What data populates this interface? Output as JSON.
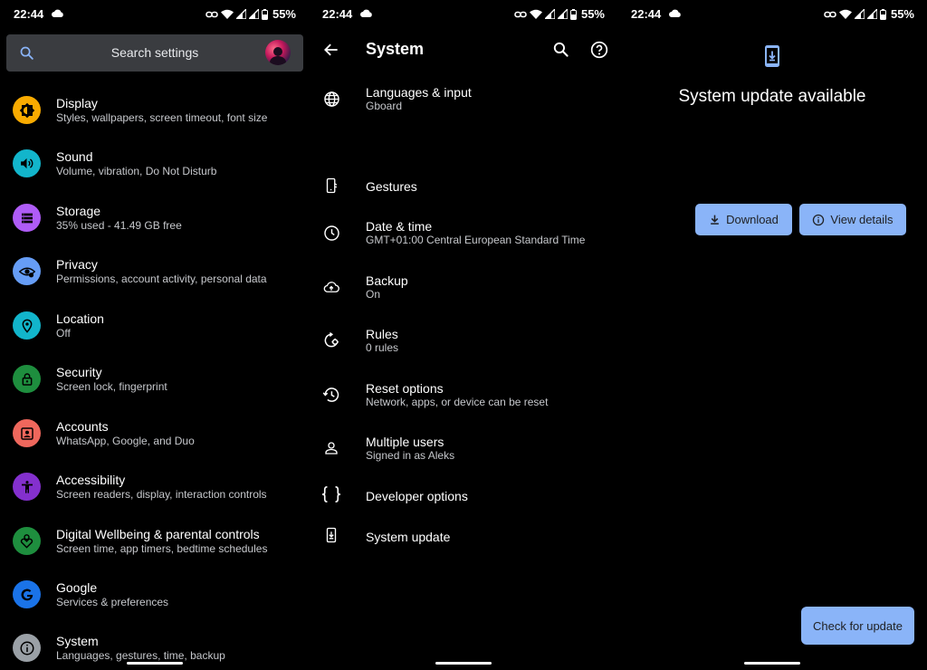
{
  "status_bar": {
    "time": "22:44",
    "battery": "55%"
  },
  "settings": {
    "search_placeholder": "Search settings",
    "items": [
      {
        "title": "Display",
        "subtitle": "Styles, wallpapers, screen timeout, font size",
        "icon": "brightness-icon",
        "color": "#f9ab00"
      },
      {
        "title": "Sound",
        "subtitle": "Volume, vibration, Do Not Disturb",
        "icon": "volume-icon",
        "color": "#12b5cb"
      },
      {
        "title": "Storage",
        "subtitle": "35% used - 41.49 GB free",
        "icon": "storage-icon",
        "color": "#af5cf7"
      },
      {
        "title": "Privacy",
        "subtitle": "Permissions, account activity, personal data",
        "icon": "privacy-eye-icon",
        "color": "#669df6"
      },
      {
        "title": "Location",
        "subtitle": "Off",
        "icon": "location-pin-icon",
        "color": "#12b5cb"
      },
      {
        "title": "Security",
        "subtitle": "Screen lock, fingerprint",
        "icon": "lock-icon",
        "color": "#1e8e3e"
      },
      {
        "title": "Accounts",
        "subtitle": "WhatsApp, Google, and Duo",
        "icon": "account-box-icon",
        "color": "#ee675c"
      },
      {
        "title": "Accessibility",
        "subtitle": "Screen readers, display, interaction controls",
        "icon": "accessibility-icon",
        "color": "#8430ce"
      },
      {
        "title": "Digital Wellbeing & parental controls",
        "subtitle": "Screen time, app timers, bedtime schedules",
        "icon": "wellbeing-icon",
        "color": "#1e8e3e"
      },
      {
        "title": "Google",
        "subtitle": "Services & preferences",
        "icon": "google-icon",
        "color": "#1a73e8"
      },
      {
        "title": "System",
        "subtitle": "Languages, gestures, time, backup",
        "icon": "info-icon",
        "color": "#9aa0a6"
      }
    ]
  },
  "system": {
    "title": "System",
    "items": [
      {
        "title": "Languages & input",
        "subtitle": "Gboard",
        "icon": "globe-icon"
      },
      {
        "title": "Gestures",
        "subtitle": "",
        "icon": "gestures-phone-icon"
      },
      {
        "title": "Date & time",
        "subtitle": "GMT+01:00 Central European Standard Time",
        "icon": "clock-icon"
      },
      {
        "title": "Backup",
        "subtitle": "On",
        "icon": "cloud-upload-icon"
      },
      {
        "title": "Rules",
        "subtitle": "0 rules",
        "icon": "rules-icon"
      },
      {
        "title": "Reset options",
        "subtitle": "Network, apps, or device can be reset",
        "icon": "history-icon"
      },
      {
        "title": "Multiple users",
        "subtitle": "Signed in as Aleks",
        "icon": "person-icon"
      },
      {
        "title": "Developer options",
        "subtitle": "",
        "icon": "braces-icon"
      },
      {
        "title": "System update",
        "subtitle": "",
        "icon": "system-update-icon"
      }
    ]
  },
  "update": {
    "title": "System update available",
    "download_label": "Download",
    "view_details_label": "View details",
    "check_label": "Check for update"
  },
  "colors": {
    "accent": "#8ab4f8",
    "background": "#000000",
    "search_bg": "#3a3c40"
  }
}
